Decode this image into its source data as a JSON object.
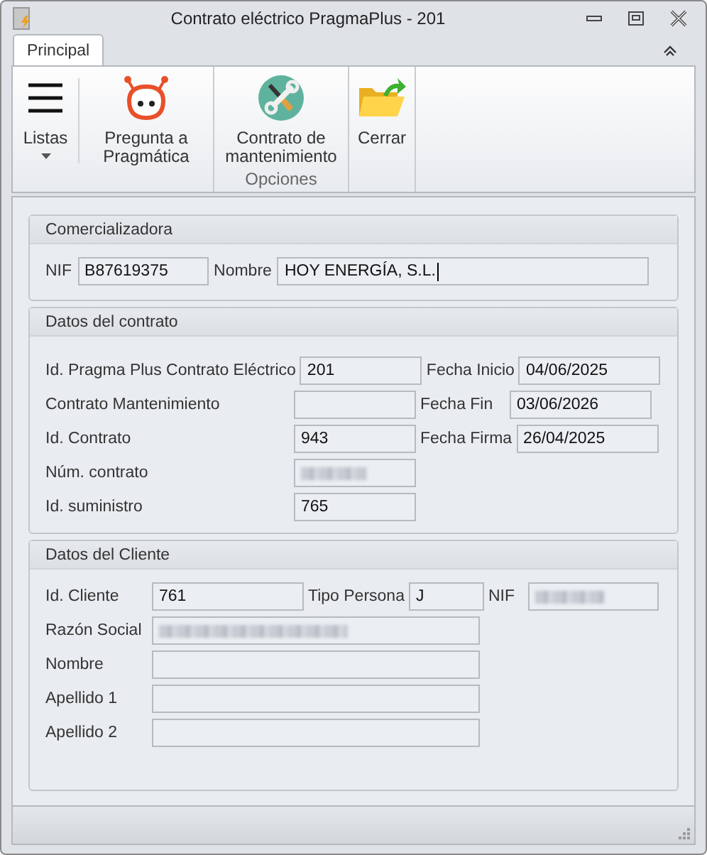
{
  "window": {
    "title": "Contrato eléctrico PragmaPlus - 201"
  },
  "tabs": [
    {
      "label": "Principal",
      "selected": true
    }
  ],
  "ribbon": {
    "groups": [
      {
        "buttons": [
          {
            "label": "Listas",
            "dropdown": true
          },
          {
            "label": "Pregunta a Pragmática",
            "dropdown": false
          }
        ]
      },
      {
        "label": "Opciones",
        "buttons": [
          {
            "label": "Contrato de mantenimiento",
            "dropdown": false
          }
        ]
      },
      {
        "buttons": [
          {
            "label": "Cerrar",
            "dropdown": false
          }
        ]
      }
    ]
  },
  "sections": [
    {
      "title": "Comercializadora",
      "kind": "company",
      "rows": [
        [
          {
            "label": "NIF",
            "value": "B87619375"
          },
          {
            "label": "Nombre",
            "value": "HOY ENERGÍA, S.L.",
            "focused": true
          }
        ]
      ]
    },
    {
      "title": "Datos del contrato",
      "kind": "contract",
      "rows": [
        [
          {
            "label": "Id. Pragma Plus Contrato Eléctrico",
            "value": "201"
          },
          {
            "label": "Fecha Inicio",
            "value": "04/06/2025"
          }
        ],
        [
          {
            "label": "Contrato Mantenimiento"
          },
          {
            "label": "Fecha Fin",
            "value": "03/06/2026"
          }
        ],
        [
          {
            "label": "Id. Contrato",
            "value": "943"
          },
          {
            "label": "Fecha Firma",
            "value": "26/04/2025"
          }
        ],
        [
          {
            "label": "Núm. contrato",
            "blurred": true
          }
        ],
        [
          {
            "label": "Id. suministro",
            "value": "765"
          }
        ]
      ]
    },
    {
      "title": "Datos del Cliente",
      "kind": "client",
      "rows": [
        [
          {
            "label": "Id. Cliente",
            "value": "761"
          },
          {
            "label": "Tipo Persona",
            "value": "J"
          },
          {
            "label": "NIF",
            "blurred": true
          }
        ],
        [
          {
            "label": "Razón Social",
            "blurred": true
          }
        ],
        [
          {
            "label": "Nombre"
          }
        ],
        [
          {
            "label": "Apellido 1"
          }
        ],
        [
          {
            "label": "Apellido 2"
          }
        ]
      ]
    }
  ]
}
